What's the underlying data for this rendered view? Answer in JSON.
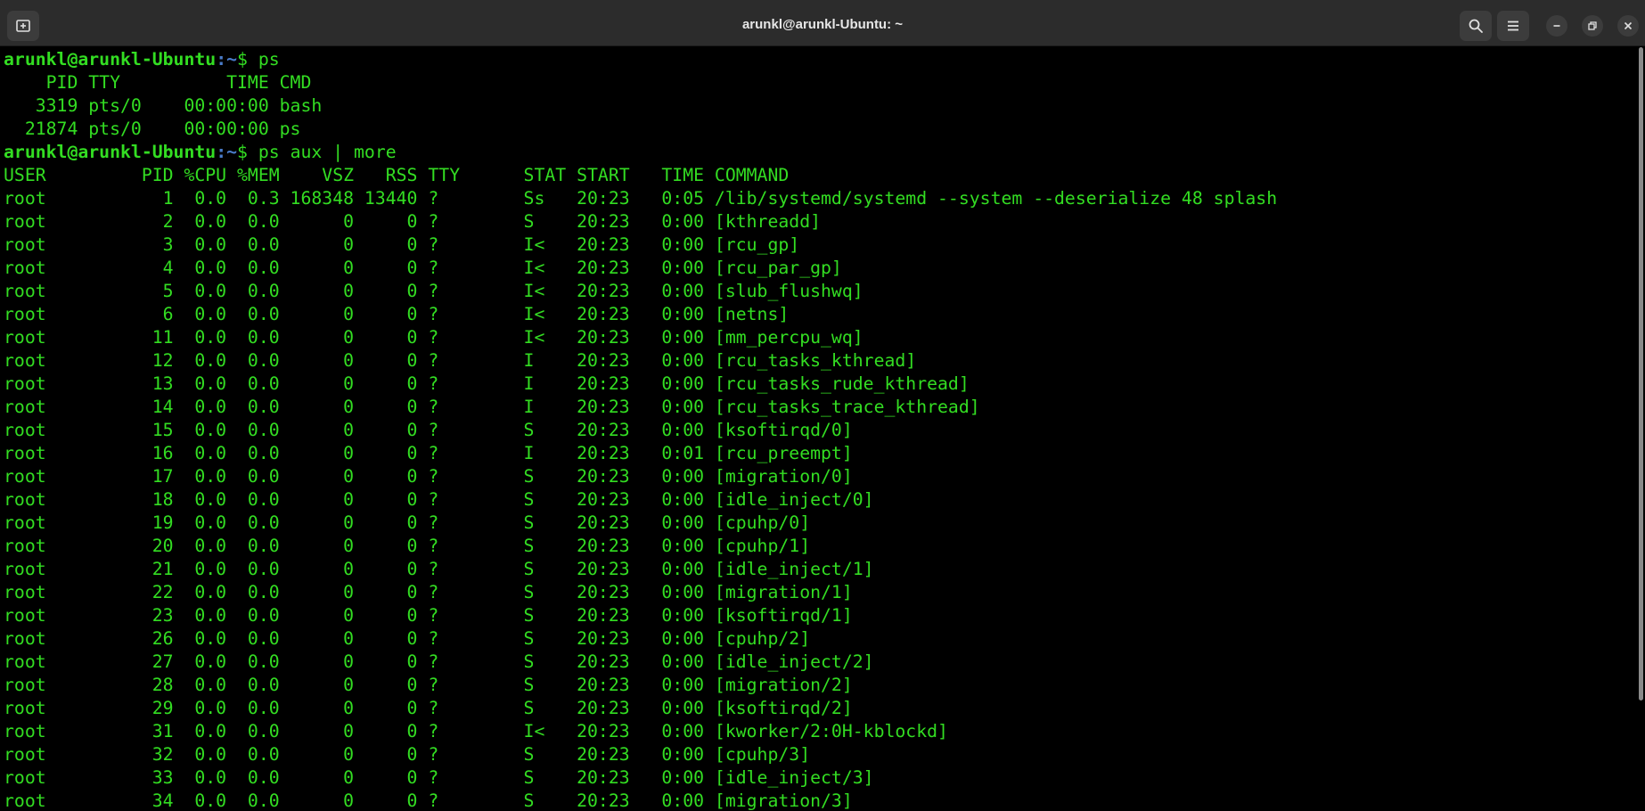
{
  "window": {
    "title": "arunkl@arunkl-Ubuntu: ~"
  },
  "terminal": {
    "prompt_user_host": "arunkl@arunkl-Ubuntu",
    "prompt_path": ":~",
    "prompt_symbol": "$ ",
    "cmd1": "ps",
    "ps_lines": [
      "    PID TTY          TIME CMD",
      "   3319 pts/0    00:00:00 bash",
      "  21874 pts/0    00:00:00 ps"
    ],
    "cmd2": "ps aux | more",
    "aux_header": "USER         PID %CPU %MEM    VSZ   RSS TTY      STAT START   TIME COMMAND",
    "aux_rows": [
      "root           1  0.0  0.3 168348 13440 ?        Ss   20:23   0:05 /lib/systemd/systemd --system --deserialize 48 splash",
      "root           2  0.0  0.0      0     0 ?        S    20:23   0:00 [kthreadd]",
      "root           3  0.0  0.0      0     0 ?        I<   20:23   0:00 [rcu_gp]",
      "root           4  0.0  0.0      0     0 ?        I<   20:23   0:00 [rcu_par_gp]",
      "root           5  0.0  0.0      0     0 ?        I<   20:23   0:00 [slub_flushwq]",
      "root           6  0.0  0.0      0     0 ?        I<   20:23   0:00 [netns]",
      "root          11  0.0  0.0      0     0 ?        I<   20:23   0:00 [mm_percpu_wq]",
      "root          12  0.0  0.0      0     0 ?        I    20:23   0:00 [rcu_tasks_kthread]",
      "root          13  0.0  0.0      0     0 ?        I    20:23   0:00 [rcu_tasks_rude_kthread]",
      "root          14  0.0  0.0      0     0 ?        I    20:23   0:00 [rcu_tasks_trace_kthread]",
      "root          15  0.0  0.0      0     0 ?        S    20:23   0:00 [ksoftirqd/0]",
      "root          16  0.0  0.0      0     0 ?        I    20:23   0:01 [rcu_preempt]",
      "root          17  0.0  0.0      0     0 ?        S    20:23   0:00 [migration/0]",
      "root          18  0.0  0.0      0     0 ?        S    20:23   0:00 [idle_inject/0]",
      "root          19  0.0  0.0      0     0 ?        S    20:23   0:00 [cpuhp/0]",
      "root          20  0.0  0.0      0     0 ?        S    20:23   0:00 [cpuhp/1]",
      "root          21  0.0  0.0      0     0 ?        S    20:23   0:00 [idle_inject/1]",
      "root          22  0.0  0.0      0     0 ?        S    20:23   0:00 [migration/1]",
      "root          23  0.0  0.0      0     0 ?        S    20:23   0:00 [ksoftirqd/1]",
      "root          26  0.0  0.0      0     0 ?        S    20:23   0:00 [cpuhp/2]",
      "root          27  0.0  0.0      0     0 ?        S    20:23   0:00 [idle_inject/2]",
      "root          28  0.0  0.0      0     0 ?        S    20:23   0:00 [migration/2]",
      "root          29  0.0  0.0      0     0 ?        S    20:23   0:00 [ksoftirqd/2]",
      "root          31  0.0  0.0      0     0 ?        I<   20:23   0:00 [kworker/2:0H-kblockd]",
      "root          32  0.0  0.0      0     0 ?        S    20:23   0:00 [cpuhp/3]",
      "root          33  0.0  0.0      0     0 ?        S    20:23   0:00 [idle_inject/3]",
      "root          34  0.0  0.0      0     0 ?        S    20:23   0:00 [migration/3]"
    ]
  },
  "icons": {
    "new_tab": "new-tab-icon",
    "search": "search-icon",
    "menu": "hamburger-menu-icon",
    "minimize": "minimize-icon",
    "maximize": "restore-icon",
    "close": "close-icon"
  },
  "colors": {
    "terminal_text": "#33dd22",
    "prompt_path": "#4a7cc9",
    "background": "#000000",
    "titlebar": "#2c2c2c"
  }
}
